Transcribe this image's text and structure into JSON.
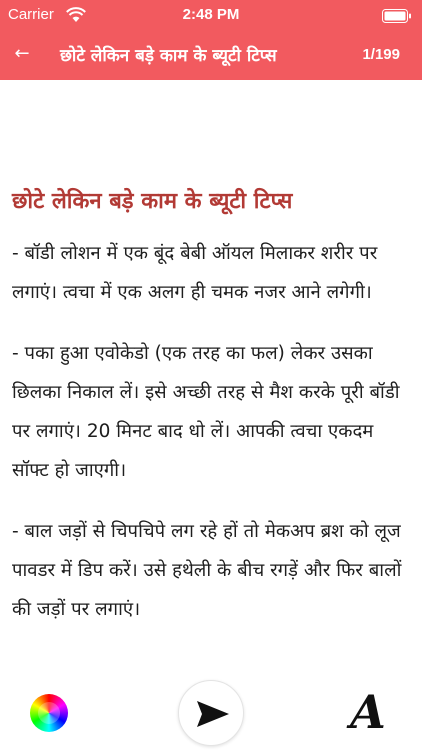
{
  "status_bar": {
    "carrier": "Carrier",
    "time": "2:48 PM"
  },
  "app_bar": {
    "back_icon": "←",
    "title": "छोटे लेकिन बड़े काम के ब्यूटी टिप्स",
    "pager": "1/199"
  },
  "article": {
    "heading": "छोटे लेकिन बड़े काम के ब्यूटी टिप्स",
    "paragraphs": [
      "- बॉडी लोशन में एक बूंद बेबी ऑयल मिलाकर शरीर पर लगाएं। त्वचा में एक अलग ही चमक नजर आने लगेगी।",
      "- पका हुआ एवोकेडो (एक तरह का फल) लेकर उसका छिलका निकाल लें। इसे अच्छी तरह से मैश करके पूरी बॉडी पर लगाएं। 20 मिनट बाद धो लें। आपकी त्वचा एकदम सॉफ्ट हो जाएगी।",
      "- बाल जड़ों से चिपचिपे लग रहे हों तो मेकअप ब्रश को लूज पावडर में डिप करें। उसे हथेली के बीच रगड़ें और फिर बालों की जड़ों पर लगाएं।"
    ]
  },
  "toolbar": {
    "color_icon": "color-wheel-icon",
    "send_icon": "send-icon",
    "font_label": "A"
  },
  "colors": {
    "accent": "#f25a5f",
    "heading": "#b23a35"
  }
}
